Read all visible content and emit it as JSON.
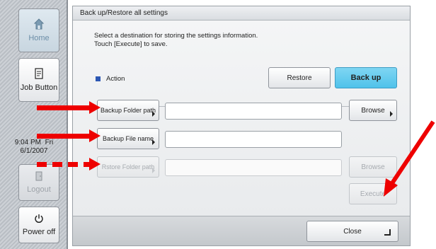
{
  "sidebar": {
    "home_label": "Home",
    "job_button_label": "Job Button",
    "clock_time": "9:04 PM  Fri",
    "clock_date": "6/1/2007",
    "logout_label": "Logout",
    "power_label": "Power off"
  },
  "dialog": {
    "title": "Back up/Restore all settings",
    "instruction_line1": "Select a destination for storing the settings information.",
    "instruction_line2": "Touch [Execute] to save.",
    "action_label": "Action",
    "restore_label": "Restore",
    "backup_label": "Back up",
    "backup_folder_label": "Backup Folder path",
    "backup_folder_value": "",
    "browse_label": "Browse",
    "backup_file_label": "Backup File name",
    "backup_file_value": "",
    "restore_folder_label": "Rstore Folder path",
    "restore_folder_value": "",
    "browse_disabled_label": "Browse",
    "execute_label": "Execute",
    "close_label": "Close"
  },
  "colors": {
    "annotation_red": "#ee0000",
    "active_button": "#50c2ea",
    "action_square": "#2c57b3"
  }
}
